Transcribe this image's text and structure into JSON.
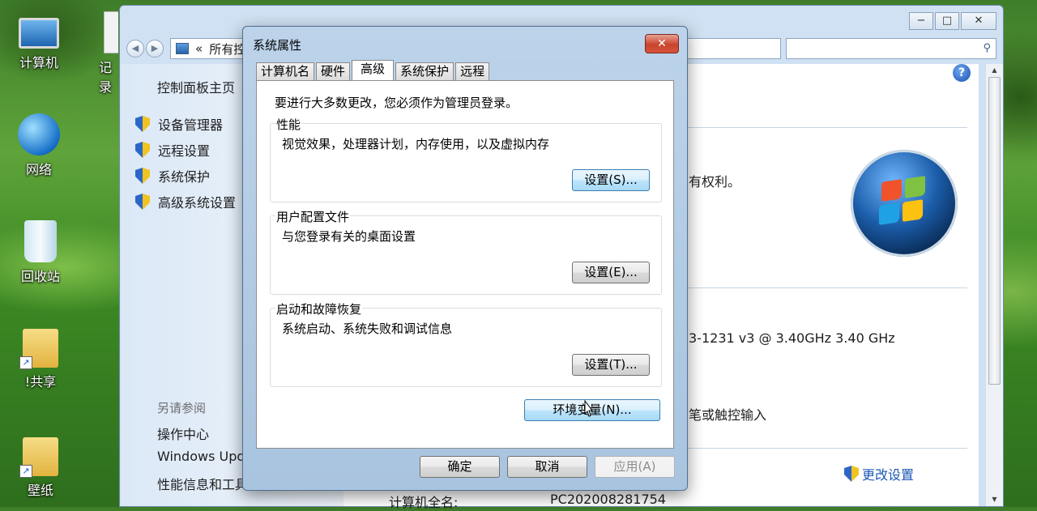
{
  "desktop": {
    "icons": [
      {
        "label": "计算机"
      },
      {
        "label": "记录"
      },
      {
        "label": "网络"
      },
      {
        "label": "回收站"
      },
      {
        "label": "!共享"
      },
      {
        "label": "壁纸"
      }
    ]
  },
  "control_panel": {
    "address_prefix": "«",
    "address_text": "所有控",
    "home_link": "控制面板主页",
    "tasks": [
      {
        "label": "设备管理器"
      },
      {
        "label": "远程设置"
      },
      {
        "label": "系统保护"
      },
      {
        "label": "高级系统设置"
      }
    ],
    "see_also_title": "另请参阅",
    "see_also": [
      {
        "label": "操作中心"
      },
      {
        "label": "Windows Upd"
      },
      {
        "label": "性能信息和工具"
      }
    ],
    "main_texts": {
      "rights": "有权利。",
      "processor": "3-1231 v3 @ 3.40GHz   3.40 GHz",
      "touch": "笔或触控输入",
      "computer_full_name_label": "计算机全名:",
      "computer_full_name_value": "PC202008281754"
    },
    "change_settings": "更改设置",
    "window_controls": {
      "minimize": "−",
      "maximize": "□",
      "close": "✕"
    }
  },
  "dialog": {
    "title": "系统属性",
    "close": "✕",
    "tabs": [
      {
        "label": "计算机名",
        "active": false
      },
      {
        "label": "硬件",
        "active": false
      },
      {
        "label": "高级",
        "active": true
      },
      {
        "label": "系统保护",
        "active": false
      },
      {
        "label": "远程",
        "active": false
      }
    ],
    "admin_note": "要进行大多数更改，您必须作为管理员登录。",
    "performance": {
      "title": "性能",
      "desc": "视觉效果，处理器计划，内存使用，以及虚拟内存",
      "button": "设置(S)..."
    },
    "user_profiles": {
      "title": "用户配置文件",
      "desc": "与您登录有关的桌面设置",
      "button": "设置(E)..."
    },
    "startup_recovery": {
      "title": "启动和故障恢复",
      "desc": "系统启动、系统失败和调试信息",
      "button": "设置(T)..."
    },
    "env_button": "环境变量(N)...",
    "ok": "确定",
    "cancel": "取消",
    "apply": "应用(A)"
  }
}
